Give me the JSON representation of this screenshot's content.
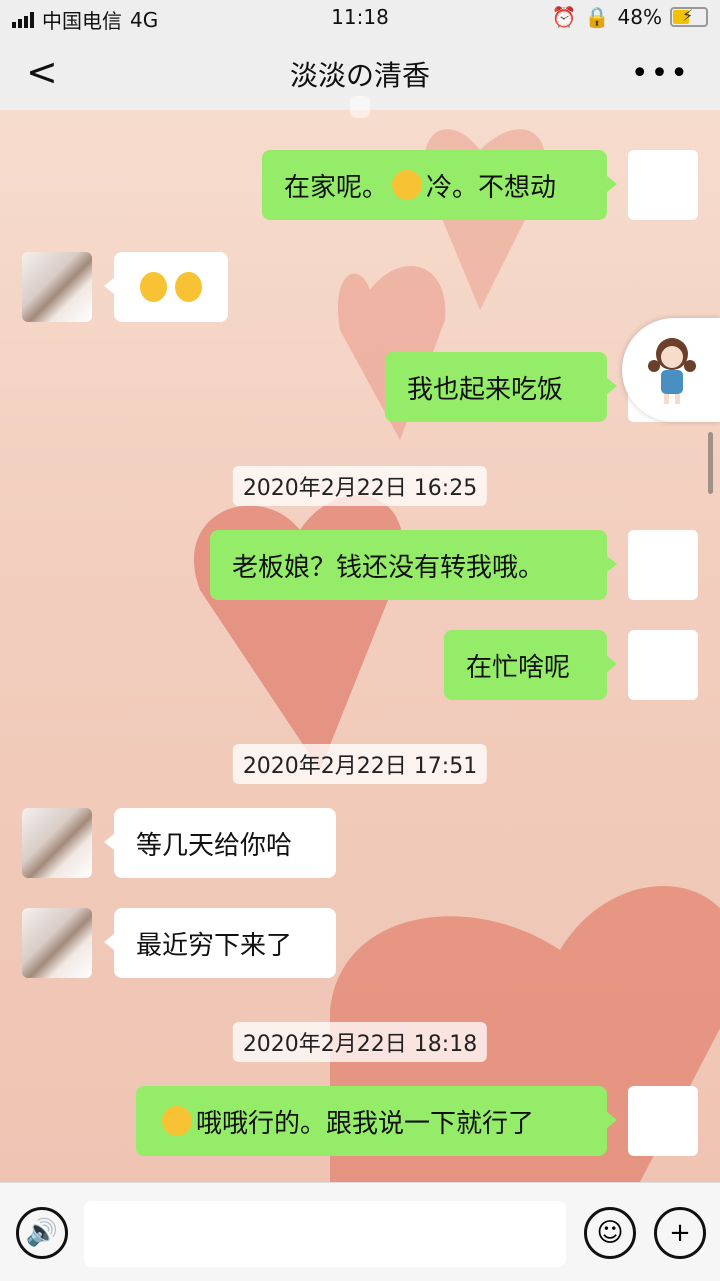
{
  "status": {
    "carrier": "中国电信",
    "network": "4G",
    "time": "11:18",
    "battery": "48%",
    "battery_level": 0.48
  },
  "nav": {
    "title": "淡淡の清香",
    "back": "<",
    "more": "•••"
  },
  "timestamps": [
    "2020年2月22日 16:25",
    "2020年2月22日 17:51",
    "2020年2月22日 18:18"
  ],
  "messages": [
    {
      "from": "me",
      "text": "在家呢。",
      "emoji_mid": "grimace",
      "text2": "冷。不想动"
    },
    {
      "from": "them",
      "emojis": [
        "grin-face",
        "grin-face"
      ]
    },
    {
      "from": "me",
      "text": "我也起来吃饭"
    },
    {
      "from": "me",
      "text": "老板娘？钱还没有转我哦。"
    },
    {
      "from": "me",
      "text": "在忙啥呢"
    },
    {
      "from": "them",
      "text": "等几天给你哈"
    },
    {
      "from": "them",
      "text": "最近穷下来了"
    },
    {
      "from": "me",
      "emoji_lead": "laugh-cry",
      "text": "哦哦行的。跟我说一下就行了"
    }
  ],
  "colors": {
    "me_bubble": "#95ec69",
    "them_bubble": "#ffffff",
    "accent_heart": "#e07a6a"
  }
}
